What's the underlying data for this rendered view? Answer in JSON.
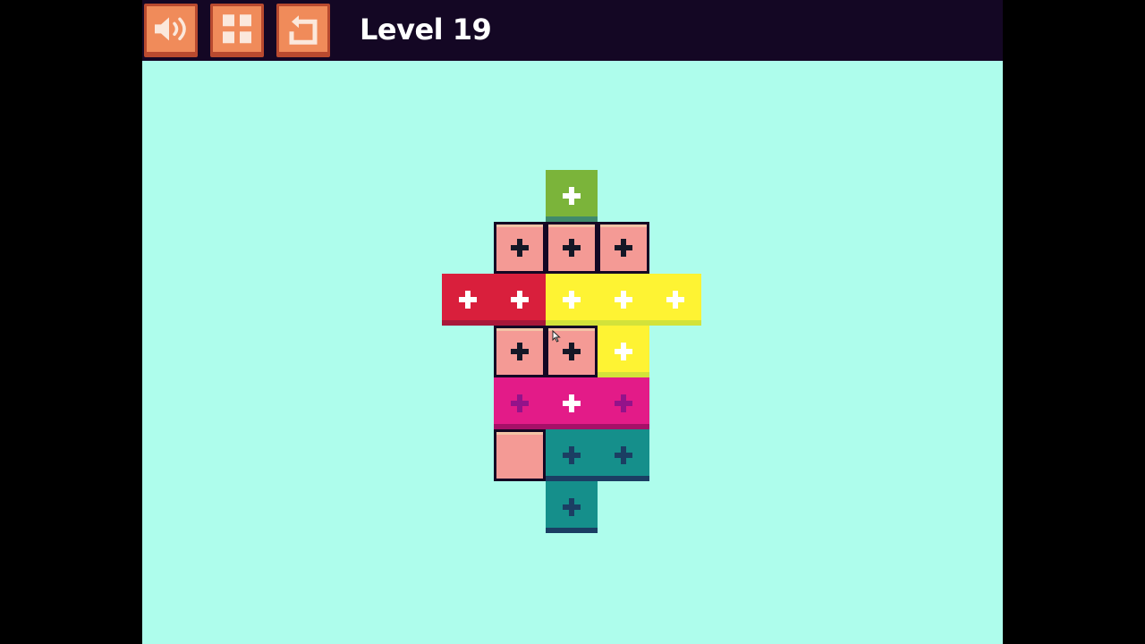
{
  "header": {
    "level_title": "Level 19",
    "buttons": [
      {
        "name": "sound-button",
        "icon": "speaker-icon"
      },
      {
        "name": "level-select-button",
        "icon": "grid-icon"
      },
      {
        "name": "restart-button",
        "icon": "restart-icon"
      }
    ]
  },
  "colors": {
    "background": "#aefdec",
    "topbar": "#140724",
    "button_fill": "#f08b5a",
    "green": "#7bb43a",
    "salmon": "#f49a95",
    "red": "#d91f3c",
    "yellow": "#fef333",
    "magenta": "#e31b88",
    "teal": "#158f8b"
  },
  "board": {
    "cells": [
      {
        "col": 2,
        "row": 0,
        "piece": "green",
        "mark": "plus-white"
      },
      {
        "col": 1,
        "row": 1,
        "piece": "salmon",
        "mark": "plus-dark"
      },
      {
        "col": 2,
        "row": 1,
        "piece": "salmon",
        "mark": "plus-dark"
      },
      {
        "col": 3,
        "row": 1,
        "piece": "salmon",
        "mark": "plus-dark"
      },
      {
        "col": 0,
        "row": 2,
        "piece": "red",
        "mark": "plus-white"
      },
      {
        "col": 1,
        "row": 2,
        "piece": "red",
        "mark": "plus-white"
      },
      {
        "col": 2,
        "row": 2,
        "piece": "yellow",
        "mark": "plus-white"
      },
      {
        "col": 3,
        "row": 2,
        "piece": "yellow",
        "mark": "plus-white"
      },
      {
        "col": 4,
        "row": 2,
        "piece": "yellow",
        "mark": "plus-white"
      },
      {
        "col": 1,
        "row": 3,
        "piece": "salmon",
        "mark": "plus-dark"
      },
      {
        "col": 2,
        "row": 3,
        "piece": "salmon",
        "mark": "plus-dark"
      },
      {
        "col": 3,
        "row": 3,
        "piece": "yellow",
        "mark": "plus-white"
      },
      {
        "col": 1,
        "row": 4,
        "piece": "magenta",
        "mark": "plus-purple"
      },
      {
        "col": 2,
        "row": 4,
        "piece": "magenta",
        "mark": "plus-white"
      },
      {
        "col": 3,
        "row": 4,
        "piece": "magenta",
        "mark": "plus-purple"
      },
      {
        "col": 1,
        "row": 5,
        "piece": "salmon",
        "mark": "none"
      },
      {
        "col": 2,
        "row": 5,
        "piece": "teal",
        "mark": "plus-navy"
      },
      {
        "col": 3,
        "row": 5,
        "piece": "teal",
        "mark": "plus-navy"
      },
      {
        "col": 2,
        "row": 6,
        "piece": "teal",
        "mark": "plus-navy"
      }
    ]
  }
}
